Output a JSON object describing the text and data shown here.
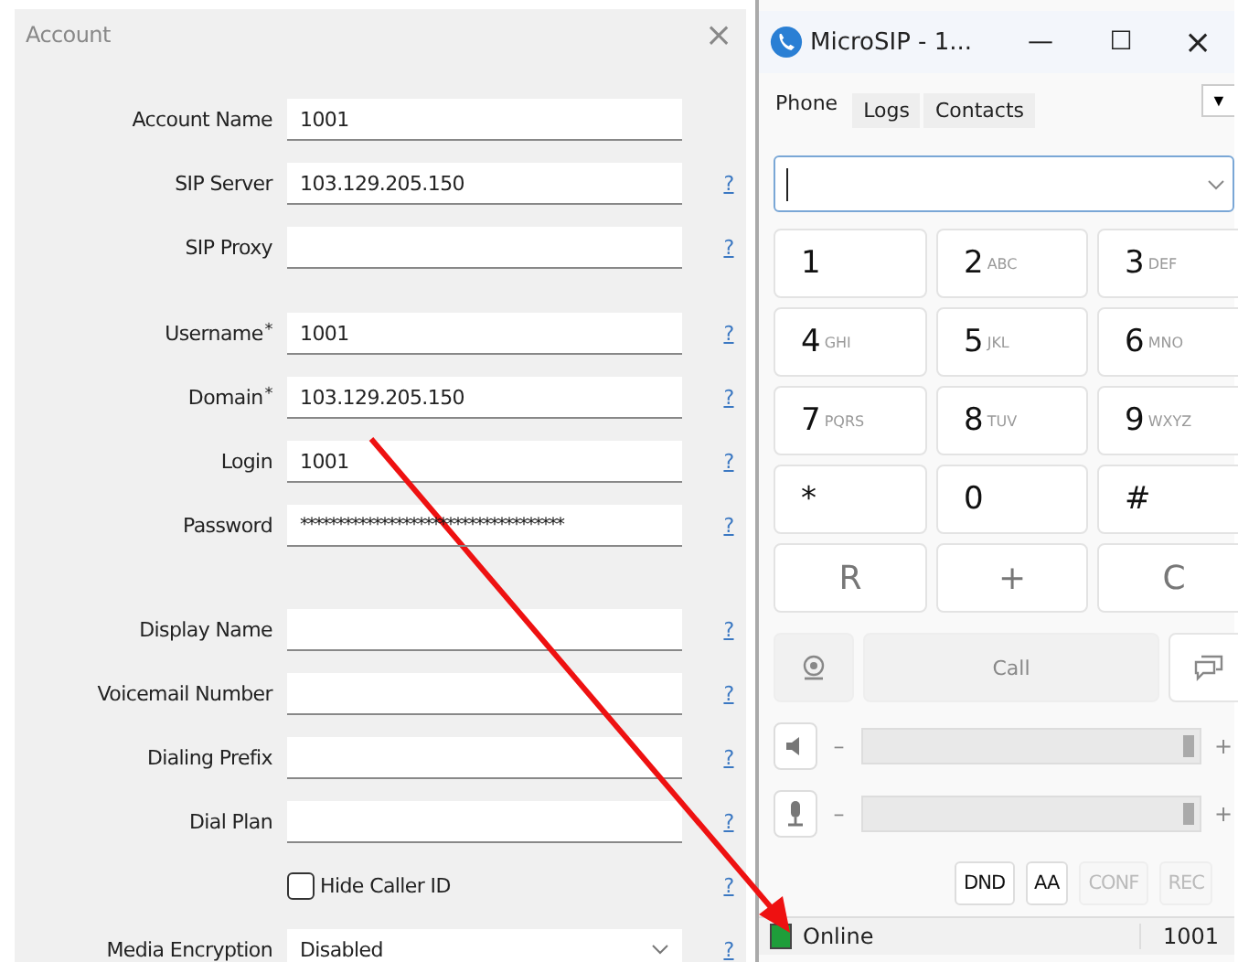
{
  "account_window": {
    "title": "Account",
    "close": "×",
    "groups": [
      [
        {
          "kind": "text",
          "label": "Account Name",
          "value": "1001"
        },
        {
          "kind": "text",
          "label": "SIP Server",
          "value": "103.129.205.150",
          "help": "?"
        },
        {
          "kind": "text",
          "label": "SIP Proxy",
          "help": "?"
        }
      ],
      [
        {
          "kind": "text",
          "label": "Username",
          "required": "*",
          "value": "1001",
          "help": "?"
        },
        {
          "kind": "text",
          "label": "Domain",
          "required": "*",
          "value": "103.129.205.150",
          "help": "?"
        },
        {
          "kind": "text",
          "label": "Login",
          "value": "1001",
          "help": "?"
        },
        {
          "kind": "password",
          "label": "Password",
          "value": "************************************",
          "help": "?"
        }
      ],
      [
        {
          "kind": "text",
          "label": "Display Name",
          "help": "?"
        },
        {
          "kind": "text",
          "label": "Voicemail Number",
          "help": "?"
        },
        {
          "kind": "text",
          "label": "Dialing Prefix",
          "help": "?"
        },
        {
          "kind": "text",
          "label": "Dial Plan",
          "help": "?"
        },
        {
          "kind": "checkbox",
          "text": "Hide Caller ID",
          "checked": false,
          "help": "?"
        },
        {
          "kind": "select",
          "label": "Media Encryption",
          "value": "Disabled",
          "help": "?"
        }
      ]
    ]
  },
  "phone_window": {
    "title": "MicroSIP - 1...",
    "minimize": "—",
    "maximize": "☐",
    "close": "×",
    "tabs": [
      {
        "label": "Phone",
        "selected": true
      },
      {
        "label": "Logs",
        "selected": false
      },
      {
        "label": "Contacts",
        "selected": false
      }
    ],
    "menu": "▼",
    "keys": [
      {
        "kind": "digit",
        "digit": "1"
      },
      {
        "kind": "digit",
        "digit": "2",
        "letters": "ABC"
      },
      {
        "kind": "digit",
        "digit": "3",
        "letters": "DEF"
      },
      {
        "kind": "digit",
        "digit": "4",
        "letters": "GHI"
      },
      {
        "kind": "digit",
        "digit": "5",
        "letters": "JKL"
      },
      {
        "kind": "digit",
        "digit": "6",
        "letters": "MNO"
      },
      {
        "kind": "digit",
        "digit": "7",
        "letters": "PQRS"
      },
      {
        "kind": "digit",
        "digit": "8",
        "letters": "TUV"
      },
      {
        "kind": "digit",
        "digit": "9",
        "letters": "WXYZ"
      },
      {
        "kind": "digit",
        "digit": "*"
      },
      {
        "kind": "digit",
        "digit": "0"
      },
      {
        "kind": "digit",
        "digit": "#"
      },
      {
        "kind": "function",
        "digit": "R"
      },
      {
        "kind": "function",
        "digit": "+"
      },
      {
        "kind": "function",
        "digit": "C"
      }
    ],
    "call": "Call",
    "volumes": [
      {
        "kind": "speaker",
        "minus": "–",
        "plus": "+",
        "level": 1
      },
      {
        "kind": "microphone",
        "minus": "–",
        "plus": "+",
        "level": 1
      }
    ],
    "toggles": [
      {
        "label": "DND",
        "disabled": false
      },
      {
        "label": "AA",
        "disabled": false
      },
      {
        "label": "CONF",
        "disabled": true
      },
      {
        "label": "REC",
        "disabled": true
      }
    ],
    "status": {
      "text": "Online",
      "color": "#1e9e3a",
      "account": "1001"
    }
  }
}
